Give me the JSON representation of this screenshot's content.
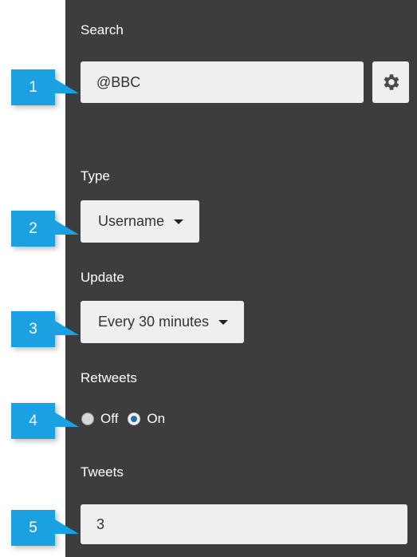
{
  "labels": {
    "search": "Search",
    "type": "Type",
    "update": "Update",
    "retweets": "Retweets",
    "tweets": "Tweets"
  },
  "search": {
    "value": "@BBC",
    "settings_icon": "gear-icon"
  },
  "type_dropdown": {
    "selected": "Username"
  },
  "update_dropdown": {
    "selected": "Every 30 minutes"
  },
  "retweets": {
    "options": [
      {
        "label": "Off",
        "checked": false
      },
      {
        "label": "On",
        "checked": true
      }
    ]
  },
  "tweets": {
    "value": "3"
  },
  "callouts": [
    "1",
    "2",
    "3",
    "4",
    "5"
  ],
  "colors": {
    "panel": "#3d3d3d",
    "field": "#efefef",
    "badge": "#1ba1e2",
    "radio_checked": "#1f6fb3"
  }
}
